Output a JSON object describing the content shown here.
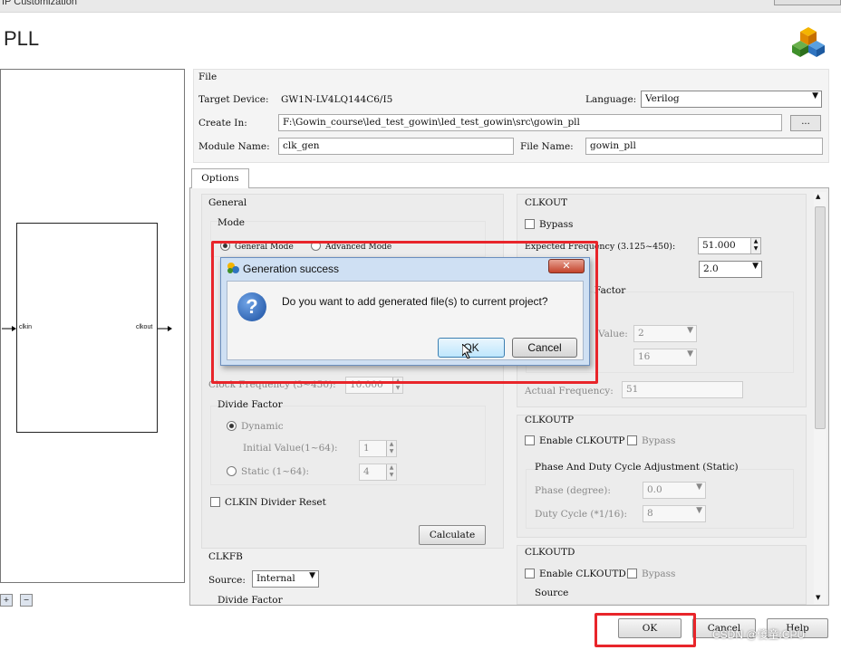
{
  "window": {
    "title": "IP Customization",
    "ip_name": "PLL"
  },
  "preview": {
    "port_in": "clkin",
    "port_out": "clkout"
  },
  "file": {
    "section_label": "File",
    "target_device_label": "Target Device:",
    "target_device_value": "GW1N-LV4LQ144C6/I5",
    "language_label": "Language:",
    "language_value": "Verilog",
    "create_in_label": "Create In:",
    "create_in_value": "F:\\Gowin_course\\led_test_gowin\\led_test_gowin\\src\\gowin_pll",
    "browse_label": "...",
    "module_name_label": "Module Name:",
    "module_name_value": "clk_gen",
    "file_name_label": "File Name:",
    "file_name_value": "gowin_pll"
  },
  "tabs": [
    {
      "label": "Options",
      "active": true
    }
  ],
  "general": {
    "title": "General",
    "mode_label": "Mode",
    "general_mode": "General Mode",
    "advanced_mode": "Advanced Mode"
  },
  "clkin": {
    "clock_frequency_label": "Clock Frequency (3~450):",
    "clock_frequency_value": "10.000",
    "divide_factor_label": "Divide Factor",
    "dynamic_label": "Dynamic",
    "initial_value_label": "Initial Value(1~64):",
    "initial_value": "1",
    "static_label": "Static (1~64):",
    "static_value": "4",
    "divider_reset_label": "CLKIN Divider Reset"
  },
  "calculate_label": "Calculate",
  "clkfb": {
    "title": "CLKFB",
    "source_label": "Source:",
    "source_value": "Internal",
    "divide_factor_label": "Divide Factor"
  },
  "clkout": {
    "title": "CLKOUT",
    "bypass_label": "Bypass",
    "expected_frequency_label": "Expected Frequency (3.125~450):",
    "expected_frequency_value": "51.000",
    "tolerance_value": "2.0",
    "divide_factor_label_partial": "Factor",
    "value_label_partial": "Value:",
    "value_dropdown": "2",
    "second_dropdown": "16",
    "actual_frequency_label": "Actual Frequency:",
    "actual_frequency_value": "51"
  },
  "clkoutp": {
    "title": "CLKOUTP",
    "enable_label": "Enable CLKOUTP",
    "bypass_label": "Bypass",
    "phase_group_label": "Phase And Duty Cycle Adjustment (Static)",
    "phase_label": "Phase (degree):",
    "phase_value": "0.0",
    "duty_label": "Duty Cycle (*1/16):",
    "duty_value": "8"
  },
  "clkoutd": {
    "title": "CLKOUTD",
    "enable_label": "Enable CLKOUTD",
    "bypass_label": "Bypass",
    "source_label": "Source"
  },
  "dialog": {
    "title": "Generation success",
    "message": "Do you want to add generated file(s) to current project?",
    "ok_label": "OK",
    "cancel_label": "Cancel"
  },
  "footer": {
    "ok_label": "OK",
    "cancel_label": "Cancel",
    "help_label": "Help"
  },
  "watermark": "CSDN @傻童:CPU",
  "colors": {
    "highlight_box": "#e8252a",
    "dialog_frame": "#cfe0f3"
  }
}
